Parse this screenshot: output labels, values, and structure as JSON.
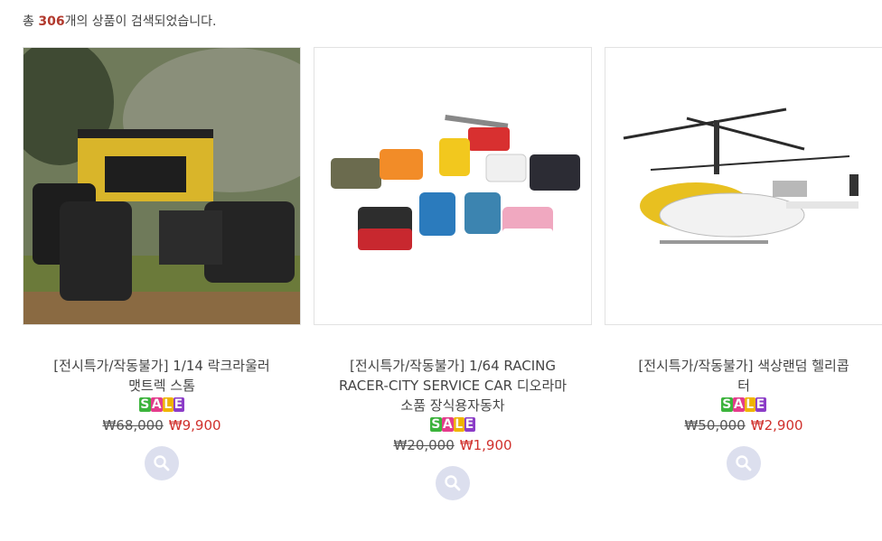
{
  "summary": {
    "prefix": "총 ",
    "count": "306",
    "suffix": "개의 상품이 검색되었습니다."
  },
  "sale_letters": [
    "S",
    "A",
    "L",
    "E"
  ],
  "sale_colors": [
    "#3cb43c",
    "#e43c8c",
    "#f0b400",
    "#8c3cc8"
  ],
  "products": [
    {
      "title_line1": "[전시특가/작동불가] 1/14 락크라울러",
      "title_line2": "맷트렉 스톰",
      "title_line3": "",
      "original_price": "₩68,000",
      "sale_price": "₩9,900"
    },
    {
      "title_line1": "[전시특가/작동불가] 1/64 RACING",
      "title_line2": "RACER-CITY SERVICE CAR 디오라마",
      "title_line3": "소품 장식용자동차",
      "original_price": "₩20,000",
      "sale_price": "₩1,900"
    },
    {
      "title_line1": "[전시특가/작동불가] 색상랜덤 헬리콥",
      "title_line2": "터",
      "title_line3": "",
      "original_price": "₩50,000",
      "sale_price": "₩2,900"
    }
  ]
}
